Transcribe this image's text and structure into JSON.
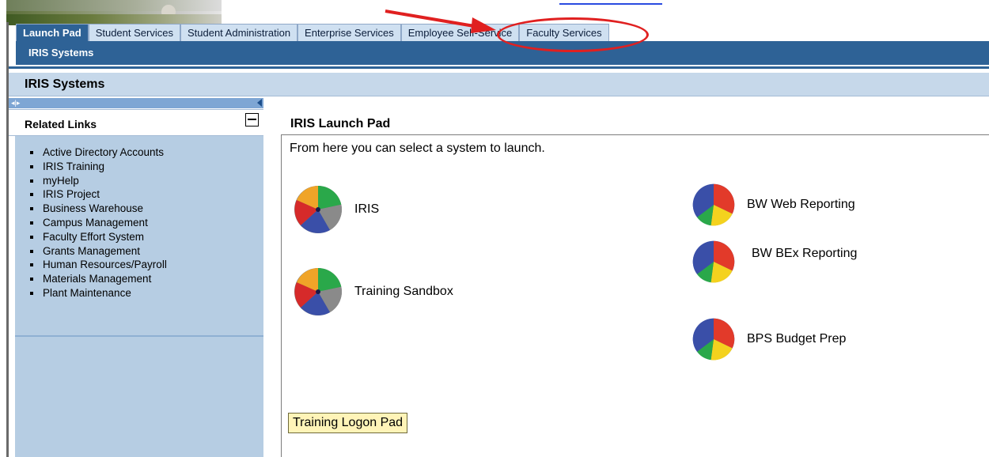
{
  "tabs": [
    {
      "label": "Launch Pad",
      "active": true
    },
    {
      "label": "Student Services",
      "active": false
    },
    {
      "label": "Student Administration",
      "active": false
    },
    {
      "label": "Enterprise Services",
      "active": false
    },
    {
      "label": "Employee Self-Service",
      "active": false
    },
    {
      "label": "Faculty Services",
      "active": false
    }
  ],
  "nav": {
    "current": "IRIS Systems"
  },
  "page_title": "IRIS Systems",
  "related_links": {
    "title": "Related Links",
    "items": [
      "Active Directory Accounts",
      "IRIS Training",
      "myHelp",
      "IRIS Project",
      "Business Warehouse",
      "Campus Management",
      "Faculty Effort System",
      "Grants Management",
      "Human Resources/Payroll",
      "Materials Management",
      "Plant Maintenance"
    ]
  },
  "launch_pad": {
    "title": "IRIS Launch Pad",
    "intro": "From here you can select a system to launch.",
    "systems": [
      {
        "label": "IRIS",
        "icon": "sap-pie-icon"
      },
      {
        "label": "Training Sandbox",
        "icon": "sap-pie-icon"
      },
      {
        "label": "BW Web Reporting",
        "icon": "bw-pie-icon"
      },
      {
        "label": "BW BEx Reporting",
        "icon": "bw-pie-icon"
      },
      {
        "label": "BPS Budget Prep",
        "icon": "bw-pie-icon"
      }
    ],
    "logon_button": "Training Logon Pad"
  },
  "colors": {
    "nav_blue": "#2e6296",
    "tab_bg": "#cfe0f1",
    "panel_bg": "#b6cde3",
    "annotation_red": "#e02020",
    "button_yellow": "#fff4b8"
  }
}
